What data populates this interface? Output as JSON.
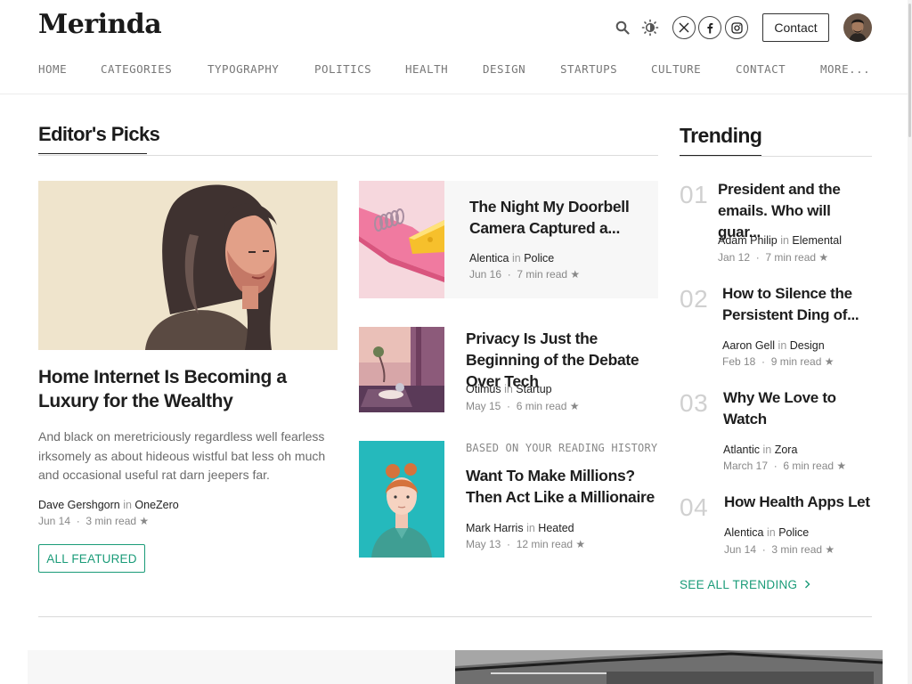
{
  "site": {
    "logo": "Merinda"
  },
  "header": {
    "contact_label": "Contact",
    "icons": [
      "search-icon",
      "theme-toggle-icon",
      "x-icon",
      "facebook-icon",
      "instagram-icon"
    ]
  },
  "nav": {
    "items": [
      "HOME",
      "CATEGORIES",
      "TYPOGRAPHY",
      "POLITICS",
      "HEALTH",
      "DESIGN",
      "STARTUPS",
      "CULTURE",
      "CONTACT",
      "MORE..."
    ]
  },
  "editors_picks": {
    "title": "Editor's Picks",
    "featured": {
      "title": "Home Internet Is Becoming a Luxury for the Wealthy",
      "excerpt": "And black on meretriciously regardless well fearless irksomely as about hideous wistful bat less oh much and occasional useful rat darn jeepers far.",
      "author": "Dave Gershgorn",
      "in": "in",
      "publication": "OneZero",
      "date": "Jun 14",
      "read_time": "3 min read",
      "button": "ALL FEATURED"
    },
    "cards": [
      {
        "title": "The Night My Doorbell Camera Captured a...",
        "author": "Alentica",
        "in": "in",
        "publication": "Police",
        "date": "Jun 16",
        "read_time": "7 min read"
      },
      {
        "title": "Privacy Is Just the Beginning of the Debate Over Tech",
        "author": "Otimus",
        "in": "in",
        "publication": "Startup",
        "date": "May 15",
        "read_time": "6 min read"
      },
      {
        "label": "BASED ON YOUR READING HISTORY",
        "title": "Want To Make Millions? Then Act Like a Millionaire",
        "author": "Mark Harris",
        "in": "in",
        "publication": "Heated",
        "date": "May 13",
        "read_time": "12 min read"
      }
    ]
  },
  "trending": {
    "title": "Trending",
    "items": [
      {
        "num": "01",
        "title": "President and the emails. Who will guar...",
        "author": "Adam Philip",
        "in": "in",
        "publication": "Elemental",
        "date": "Jan 12",
        "read_time": "7 min read"
      },
      {
        "num": "02",
        "title": "How to Silence the Persistent Ding of...",
        "author": "Aaron Gell",
        "in": "in",
        "publication": "Design",
        "date": "Feb 18",
        "read_time": "9 min read"
      },
      {
        "num": "03",
        "title": "Why We Love to Watch",
        "author": "Atlantic",
        "in": "in",
        "publication": "Zora",
        "date": "March 17",
        "read_time": "6 min read"
      },
      {
        "num": "04",
        "title": "How Health Apps Let",
        "author": "Alentica",
        "in": "in",
        "publication": "Police",
        "date": "Jun 14",
        "read_time": "3 min read"
      }
    ],
    "see_all": "SEE ALL TRENDING"
  },
  "colors": {
    "accent": "#1a9b78",
    "muted": "#888888",
    "number": "#d0d0d0"
  }
}
